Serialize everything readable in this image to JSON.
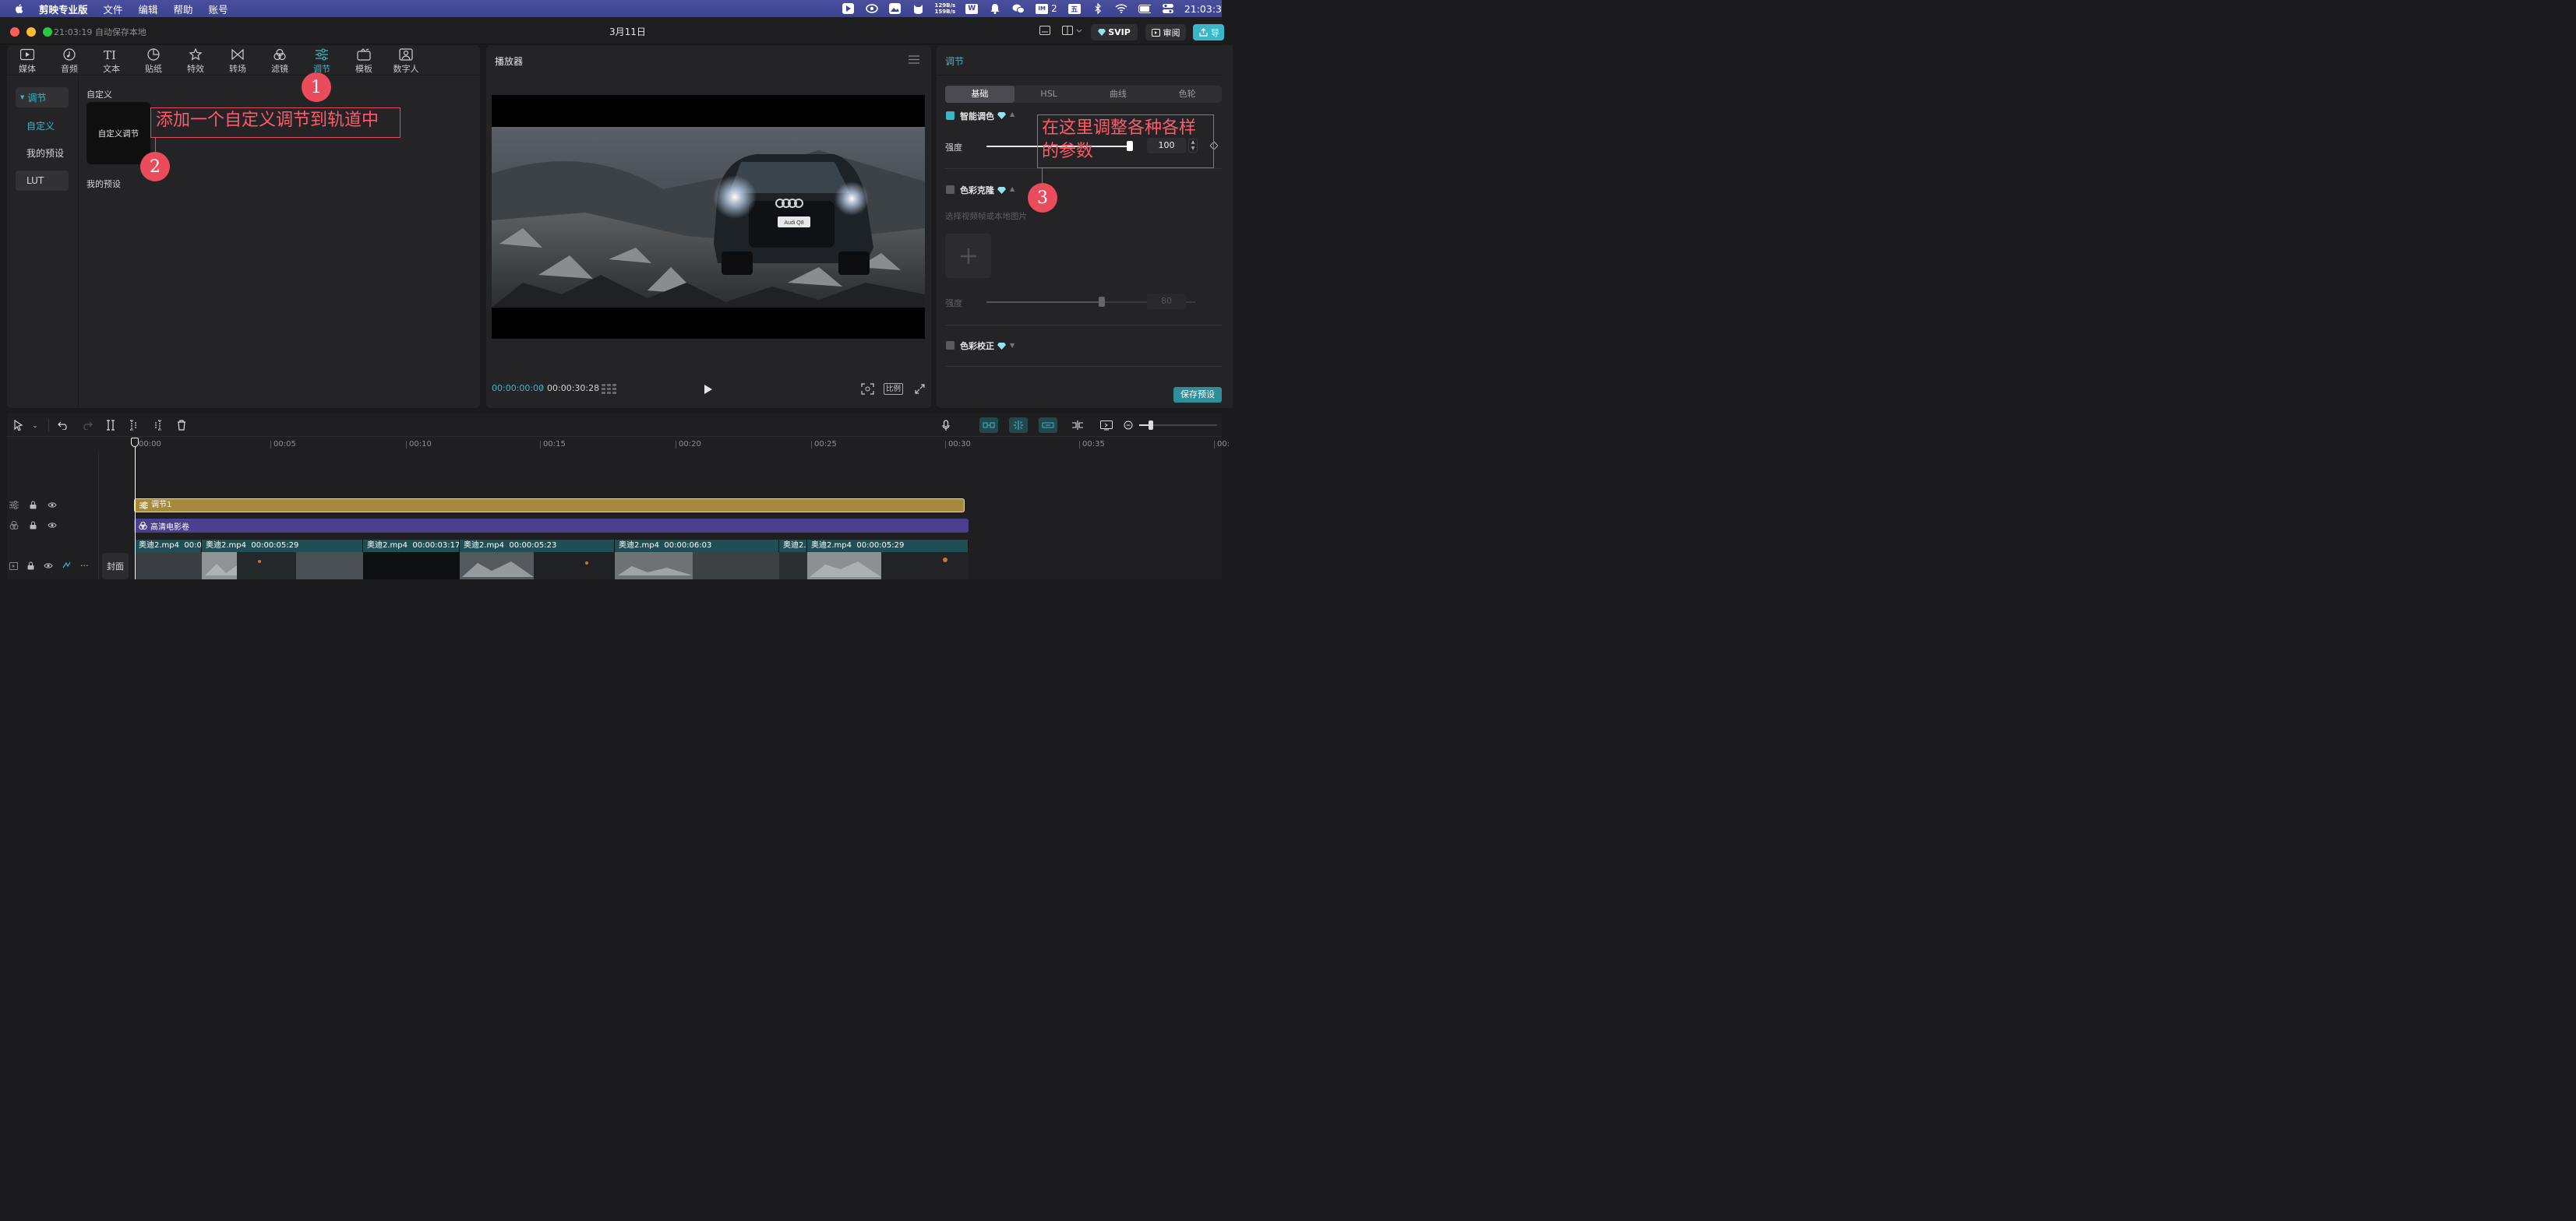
{
  "menubar": {
    "app_name": "剪映专业版",
    "menus": [
      "文件",
      "编辑",
      "帮助",
      "账号"
    ],
    "net_speed_up": "129B/s",
    "net_speed_down": "159B/s",
    "badge_number": "2",
    "ime_label": "五",
    "clock": "21:03:3"
  },
  "window": {
    "save_status": "21:03:19 自动保存本地",
    "title": "3月11日",
    "svip_label": "SVIP",
    "review_label": "审阅",
    "export_label": "导"
  },
  "toolbar": {
    "tools": [
      {
        "label": "媒体",
        "icon": "media-icon"
      },
      {
        "label": "音频",
        "icon": "audio-icon"
      },
      {
        "label": "文本",
        "icon": "text-icon"
      },
      {
        "label": "贴纸",
        "icon": "sticker-icon"
      },
      {
        "label": "特效",
        "icon": "effects-icon"
      },
      {
        "label": "转场",
        "icon": "transition-icon"
      },
      {
        "label": "滤镜",
        "icon": "filter-icon"
      },
      {
        "label": "调节",
        "icon": "adjust-icon"
      },
      {
        "label": "模板",
        "icon": "template-icon"
      },
      {
        "label": "数字人",
        "icon": "digital-human-icon"
      }
    ],
    "active_index": 7
  },
  "left_sidebar": {
    "section": "调节",
    "items": [
      "自定义",
      "我的预设",
      "LUT"
    ]
  },
  "library": {
    "custom_heading": "自定义",
    "custom_card": "自定义调节",
    "presets_heading": "我的预设"
  },
  "player": {
    "title": "播放器",
    "current_time": "00:00:00:00",
    "total_time": "00:00:30:28",
    "ratio_label": "比例",
    "car_badge": "Audi Q8"
  },
  "adjust_panel": {
    "title": "调节",
    "tabs": [
      "基础",
      "HSL",
      "曲线",
      "色轮"
    ],
    "active_tab": 0,
    "smart_color": {
      "label": "智能调色",
      "strength_label": "强度",
      "value": "100"
    },
    "color_clone": {
      "label": "色彩克隆",
      "hint": "选择视频帧或本地图片",
      "strength_label": "强度",
      "value": "80"
    },
    "color_correct": {
      "label": "色彩校正"
    },
    "save_preset": "保存预设"
  },
  "annotations": {
    "badge1": "1",
    "badge2": "2",
    "badge3": "3",
    "callout2": "添加一个自定义调节到轨道中",
    "callout3": "在这里调整各种各样的参数"
  },
  "timeline": {
    "ticks": [
      "00:00",
      "00:05",
      "00:10",
      "00:15",
      "00:20",
      "00:25",
      "00:30",
      "00:35",
      "00:"
    ],
    "adjust_track_label": "调节1",
    "filter_track_label": "高清电影卷",
    "cover_label": "封面",
    "clips": [
      {
        "name": "奥迪2.mp4",
        "duration": "00:00"
      },
      {
        "name": "奥迪2.mp4",
        "duration": "00:00:05:29"
      },
      {
        "name": "奥迪2.mp4",
        "duration": "00:00:03:17"
      },
      {
        "name": "奥迪2.mp4",
        "duration": "00:00:05:23"
      },
      {
        "name": "奥迪2.mp4",
        "duration": "00:00:06:03"
      },
      {
        "name": "奥迪2.r",
        "duration": ""
      },
      {
        "name": "奥迪2.mp4",
        "duration": "00:00:05:29"
      }
    ]
  },
  "colors": {
    "accent": "#39b7c9",
    "annotation_red": "#ea4c5b",
    "adjust_track": "#a58a3e",
    "filter_track": "#4b3f8e",
    "video_clip": "#1f4f55"
  }
}
